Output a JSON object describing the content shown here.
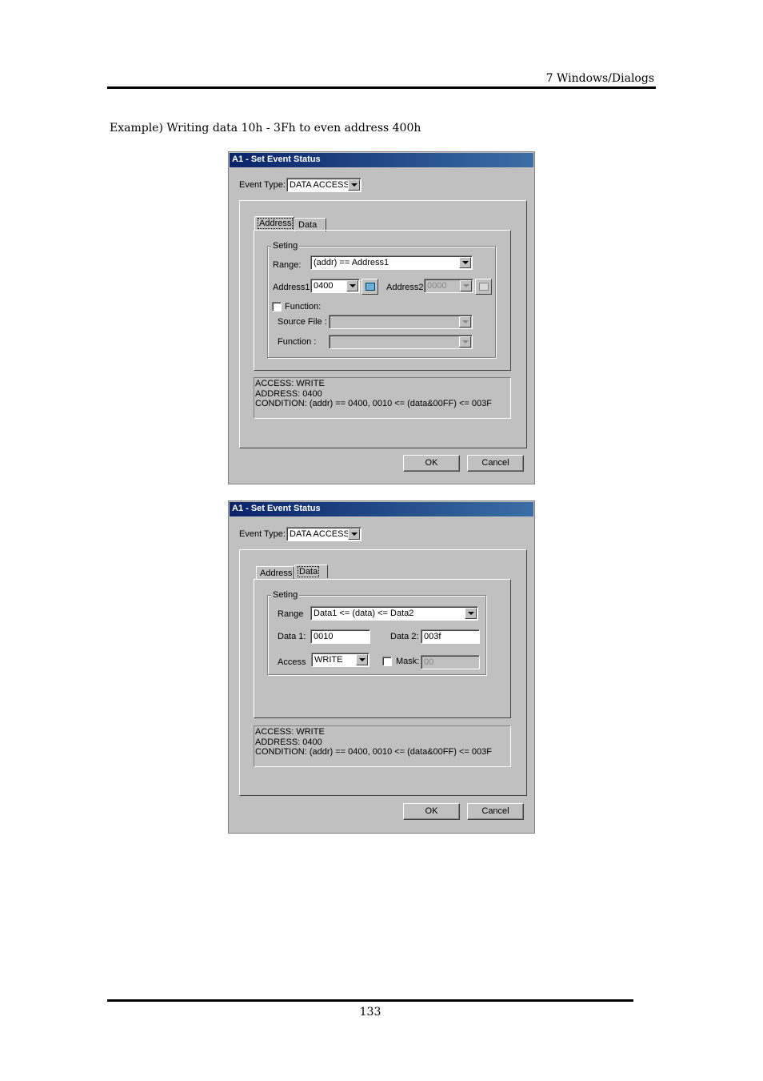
{
  "header": {
    "section": "7  Windows/Dialogs"
  },
  "caption": "Example) Writing data 10h - 3Fh to even address 400h",
  "footer": {
    "page_number": "133"
  },
  "dialog1": {
    "title": "A1 - Set Event Status",
    "event_type_label": "Event Type:",
    "event_type_value": "DATA ACCESS",
    "tabs": [
      "Address",
      "Data"
    ],
    "group_label": "Seting",
    "range_label": "Range:",
    "range_value": "(addr) == Address1",
    "address1_label": "Address1:",
    "address1_value": "0400",
    "address2_label": "Address2:",
    "address2_value": "0000",
    "function_check_label": "Function:",
    "source_file_label": "Source File :",
    "function_label": "Function :",
    "info": [
      "ACCESS: WRITE",
      "ADDRESS: 0400",
      "CONDITION: (addr) == 0400, 0010 <= (data&00FF) <= 003F"
    ],
    "ok": "OK",
    "cancel": "Cancel"
  },
  "dialog2": {
    "title": "A1 - Set Event Status",
    "event_type_label": "Event Type:",
    "event_type_value": "DATA ACCESS",
    "tabs": [
      "Address",
      "Data"
    ],
    "group_label": "Seting",
    "range_label": "Range",
    "range_value": "Data1 <= (data) <= Data2",
    "data1_label": "Data 1:",
    "data1_value": "0010",
    "data2_label": "Data 2:",
    "data2_value": "003f",
    "access_label": "Access",
    "access_value": "WRITE",
    "mask_label": "Mask:",
    "mask_value": "00",
    "info": [
      "ACCESS: WRITE",
      "ADDRESS: 0400",
      "CONDITION: (addr) == 0400, 0010 <= (data&00FF) <= 003F"
    ],
    "ok": "OK",
    "cancel": "Cancel"
  }
}
